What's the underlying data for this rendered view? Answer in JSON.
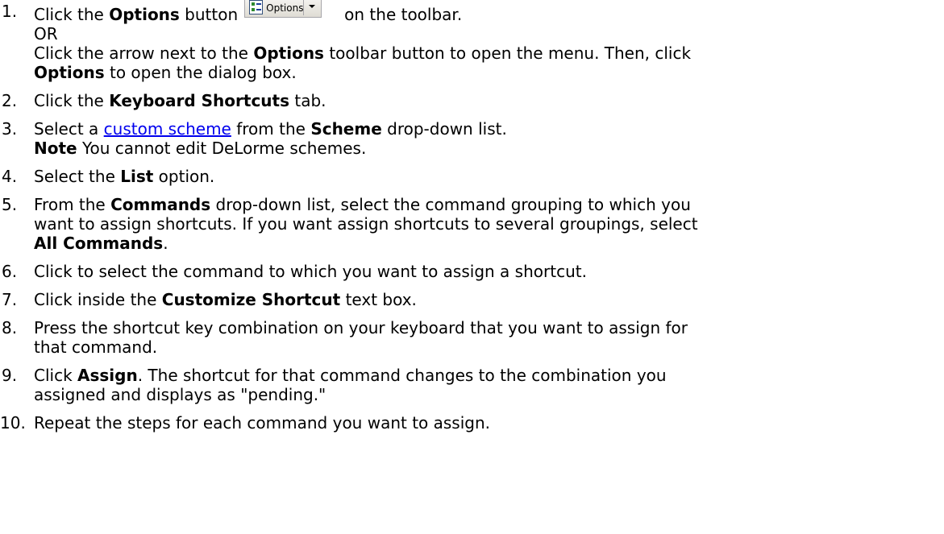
{
  "toolbar_button": {
    "label": "Options",
    "icon": "options-checklist-icon"
  },
  "steps": [
    {
      "num": "1.",
      "a": "Click the ",
      "b": "Options",
      "c": " button",
      "d": "on the toolbar.",
      "or": "OR",
      "alt_a": "Click the arrow next to the ",
      "alt_b": "Options",
      "alt_c": " toolbar button to open the menu. Then, click",
      "alt_d": "Options",
      "alt_e": " to open the dialog box."
    },
    {
      "num": "2.",
      "a": "Click the ",
      "b": "Keyboard Shortcuts",
      "c": " tab."
    },
    {
      "num": "3.",
      "a": "Select a ",
      "link": "custom scheme",
      "b": " from the ",
      "c": "Scheme",
      "d": " drop-down list.",
      "note_label": "Note",
      "note_text": " You cannot edit DeLorme schemes."
    },
    {
      "num": "4.",
      "a": "Select the ",
      "b": "List",
      "c": " option."
    },
    {
      "num": "5.",
      "a": "From the ",
      "b": "Commands",
      "c": " drop-down list, select the command grouping to which you",
      "d": "want to assign shortcuts. If you want assign shortcuts to several groupings, select",
      "e": "All Commands",
      "f": "."
    },
    {
      "num": "6.",
      "a": "Click to select the command to which you want to assign a shortcut."
    },
    {
      "num": "7.",
      "a": "Click inside the ",
      "b": "Customize Shortcut",
      "c": " text box."
    },
    {
      "num": "8.",
      "a": "Press the shortcut key combination on your keyboard that you want to assign for",
      "b": "that command."
    },
    {
      "num": "9.",
      "a": "Click ",
      "b": "Assign",
      "c": ". The shortcut for that command changes to the combination you",
      "d": "assigned and displays as \"pending.\""
    },
    {
      "num": "10.",
      "a": "Repeat the steps for each command you want to assign."
    }
  ]
}
